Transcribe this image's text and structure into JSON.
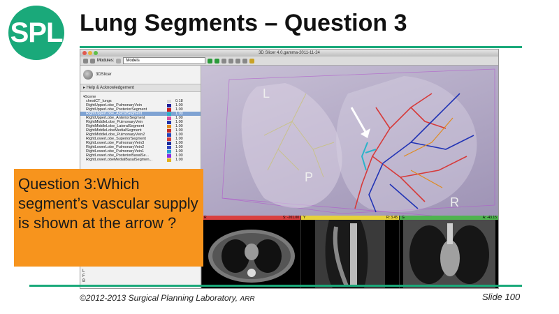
{
  "logo": "SPL",
  "title": "Lung Segments – Question 3",
  "footer": {
    "copyright": "©2012-2013 Surgical Planning Laboratory,",
    "rights": "ARR",
    "slide": "Slide 100"
  },
  "question": "Question 3:Which segment’s vascular supply is shown at the arrow ?",
  "slicer": {
    "window_title": "3D Slicer 4.0.gamma-2011-11-24",
    "modules_label": "Modules:",
    "module_selected": "Models",
    "logo_text": "3DSlicer",
    "help_label": "Help & Acknowledgement",
    "scene_label": "Scene",
    "tree": [
      {
        "name": "chestCT_lungs",
        "value": "0.18",
        "color": "#d9d9d9",
        "selected": false
      },
      {
        "name": "RightUpperLobe_PulmonaryVein",
        "value": "1.00",
        "color": "#1f1f9a",
        "selected": false
      },
      {
        "name": "RightUpperLobe_PosteriorSegment",
        "value": "1.00",
        "color": "#cc2222",
        "selected": false
      },
      {
        "name": "RightUpperLobe_ApicalSegment",
        "value": "1.00",
        "color": "#2bb3c9",
        "selected": true
      },
      {
        "name": "RightUpperLobe_AnteriorSegment",
        "value": "1.00",
        "color": "#d94fa0",
        "selected": false
      },
      {
        "name": "RightMiddleLobe_PulmonaryVein",
        "value": "1.00",
        "color": "#2233aa",
        "selected": false
      },
      {
        "name": "RightMiddleLobe_LateralSegment",
        "value": "1.00",
        "color": "#e08a1e",
        "selected": false
      },
      {
        "name": "RightMiddleLobeMedialSegment",
        "value": "1.00",
        "color": "#c22b2b",
        "selected": false
      },
      {
        "name": "RightMiddleLobe_PulmonaryVein2",
        "value": "1.00",
        "color": "#2244bb",
        "selected": false
      },
      {
        "name": "RightLowerLobe_SuperiorSegment",
        "value": "1.00",
        "color": "#d63a3a",
        "selected": false
      },
      {
        "name": "RightLowerLobe_PulmonaryVein3",
        "value": "1.00",
        "color": "#1c2c9c",
        "selected": false
      },
      {
        "name": "RightLowerLobe_PulmonaryVein2",
        "value": "1.00",
        "color": "#3347c4",
        "selected": false
      },
      {
        "name": "RightLowerLobe_PulmonaryVein1",
        "value": "1.00",
        "color": "#27a0d8",
        "selected": false
      },
      {
        "name": "RightLowerLobe_PosteriorBasalSe...",
        "value": "1.00",
        "color": "#8a2be2",
        "selected": false
      },
      {
        "name": "RightLowerLobeMedialBasalSegmen...",
        "value": "1.00",
        "color": "#e2b21e",
        "selected": false
      }
    ],
    "lfb": [
      "L",
      "F",
      "B"
    ],
    "orientation_labels": {
      "left": "L",
      "posterior": "P",
      "right": "R"
    },
    "slice_views": [
      {
        "letter": "R",
        "offset": "S: -201.00",
        "color": "#d94040"
      },
      {
        "letter": "Y",
        "offset": "R: 3.45",
        "color": "#e6d23a"
      },
      {
        "letter": "G",
        "offset": "A: -43.15",
        "color": "#4fb34f"
      }
    ]
  }
}
